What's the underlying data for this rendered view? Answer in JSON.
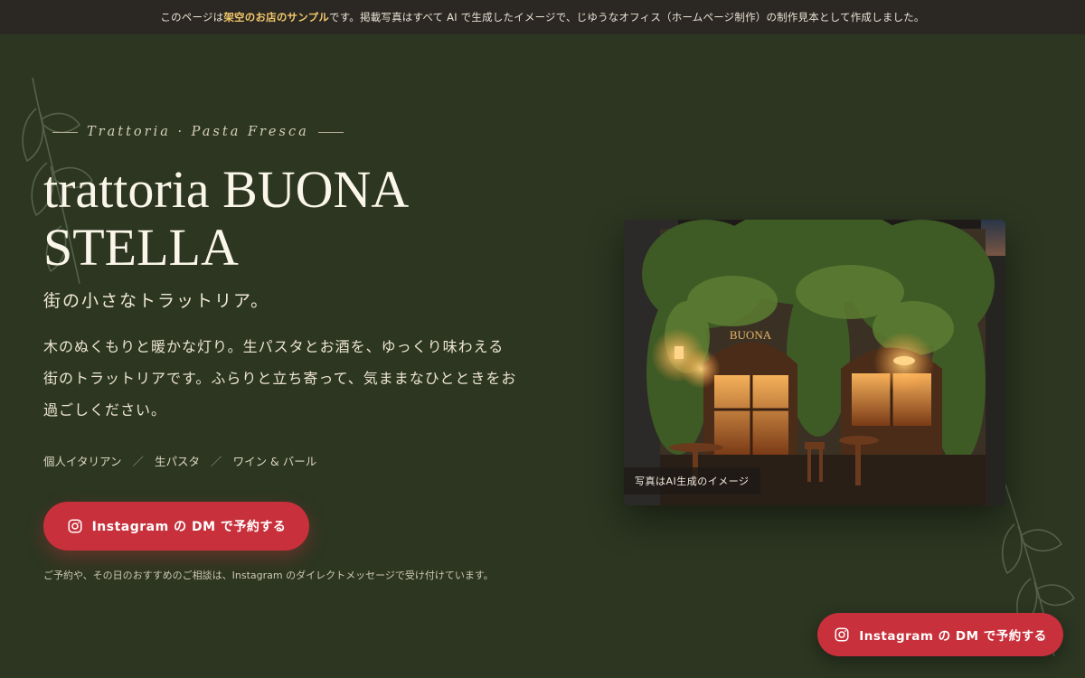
{
  "notice": {
    "prefix": "このページは ",
    "highlight": "架空のお店のサンプル",
    "suffix": " です。掲載写真はすべて AI で生成したイメージで、じゆうなオフィス（ホームページ制作）の制作見本として作成しました。"
  },
  "hero": {
    "subtitle": "Trattoria · Pasta Fresca",
    "title_line1": "trattoria BUONA",
    "title_line2": "STELLA",
    "tagline": "街の小さなトラットリア。",
    "description_line1": "木のぬくもりと暖かな灯り。生パスタとお酒を、ゆっくり味わえる",
    "description_line2": "街のトラットリアです。ふらりと立ち寄って、気ままなひとときをお",
    "description_line3": "過ごしください。",
    "tags": [
      "個人イタリアン",
      "生パスタ",
      "ワイン & バール"
    ],
    "tag_separator": "／",
    "cta_label": "Instagram の DM で予約する",
    "note": "ご予約や、その日のおすすめのご相談は、Instagram のダイレクトメッセージで受け付けています。"
  },
  "photo": {
    "caption": "写真はAI生成のイメージ",
    "sign_text": "BUONA"
  },
  "floating_cta": {
    "label": "Instagram の DM で予約する"
  },
  "icons": {
    "cta_icon": "instagram-icon",
    "decor": "leaf-branch-icon"
  },
  "colors": {
    "background": "#2c3621",
    "notice_bar": "#2b2722",
    "highlight": "#f1c86b",
    "accent_red": "#c8303b",
    "text": "#f3ecdc"
  }
}
